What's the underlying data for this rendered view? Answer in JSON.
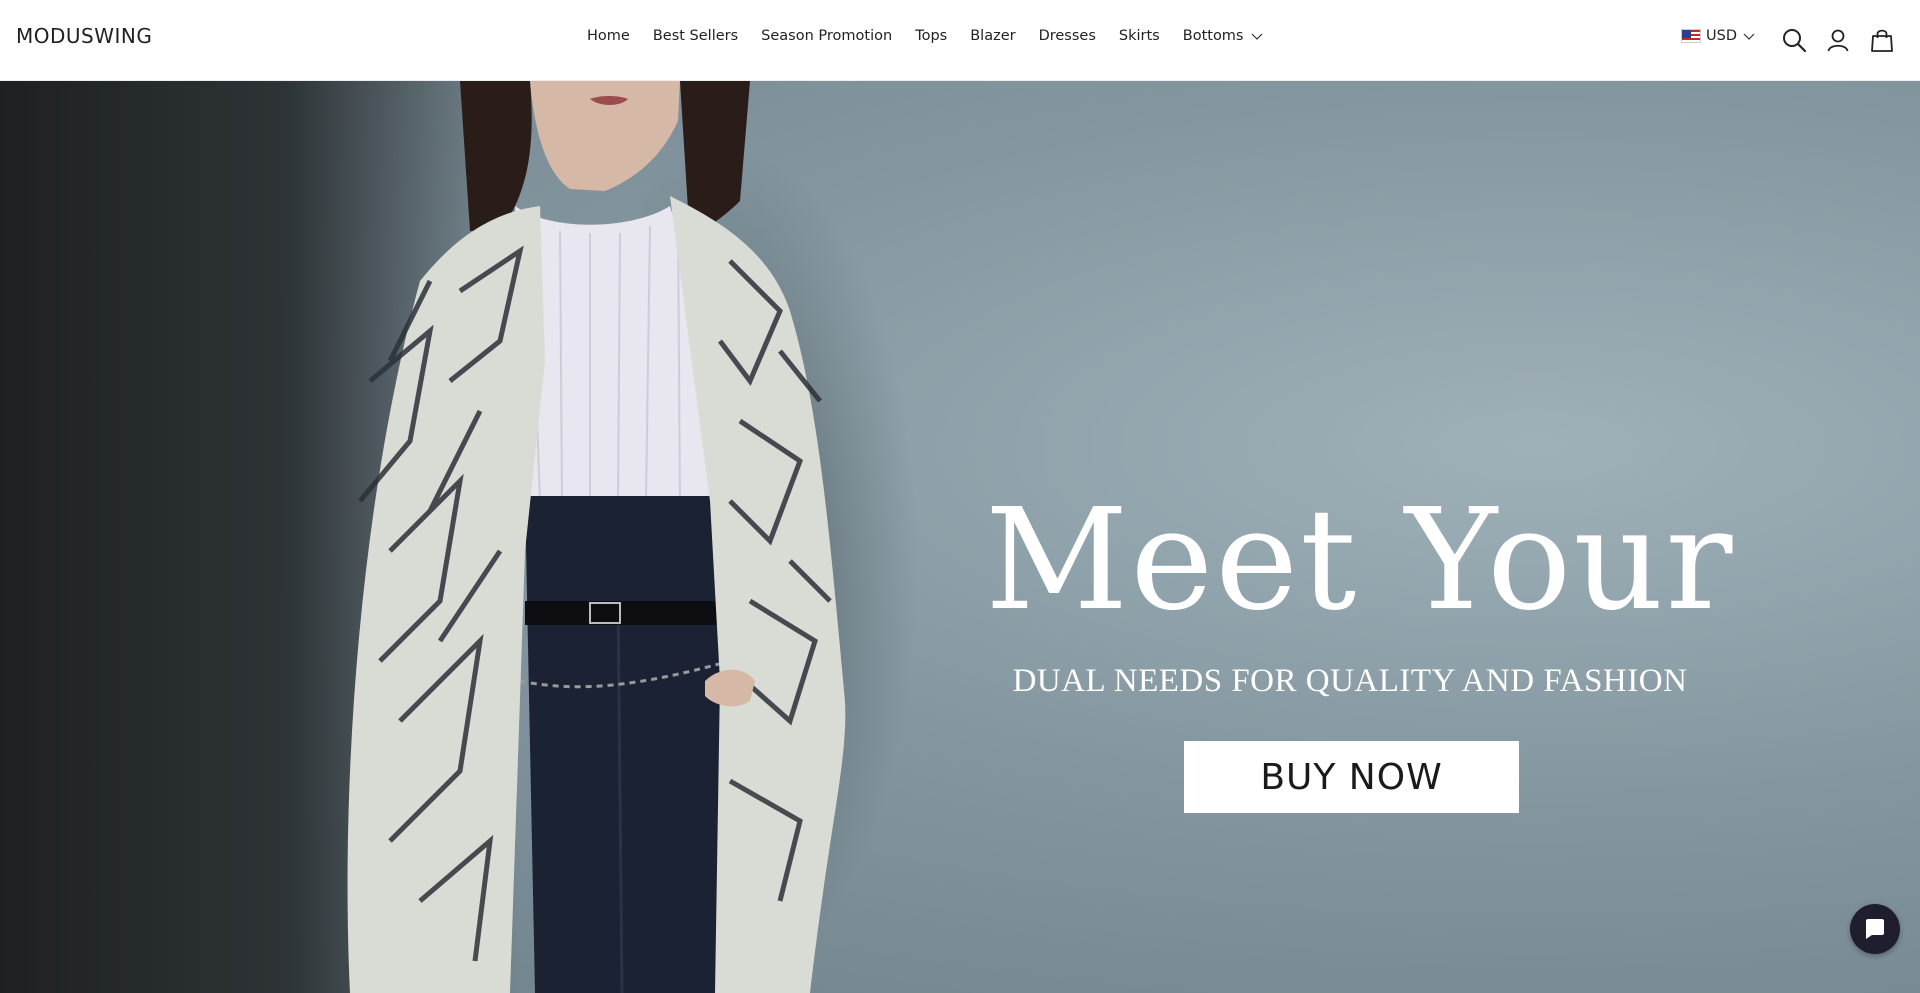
{
  "brand": {
    "logo_text": "MODUSWING"
  },
  "nav": {
    "items": [
      {
        "label": "Home"
      },
      {
        "label": "Best Sellers"
      },
      {
        "label": "Season Promotion"
      },
      {
        "label": "Tops"
      },
      {
        "label": "Blazer"
      },
      {
        "label": "Dresses"
      },
      {
        "label": "Skirts"
      },
      {
        "label": "Bottoms",
        "has_dropdown": true
      }
    ]
  },
  "header_actions": {
    "currency": "USD",
    "currency_flag": "us-flag-icon",
    "icons": [
      "search-icon",
      "account-icon",
      "cart-bag-icon"
    ]
  },
  "hero": {
    "title": "Meet Your",
    "subtitle": "DUAL NEEDS FOR QUALITY AND FASHION",
    "cta_label": "BUY NOW"
  },
  "chat": {
    "icon": "chat-icon",
    "color": "#1e1e2e"
  },
  "colors": {
    "header_bg": "#ffffff",
    "hero_bg": "#8497a0",
    "text": "#222222",
    "cta_bg": "#ffffff"
  }
}
